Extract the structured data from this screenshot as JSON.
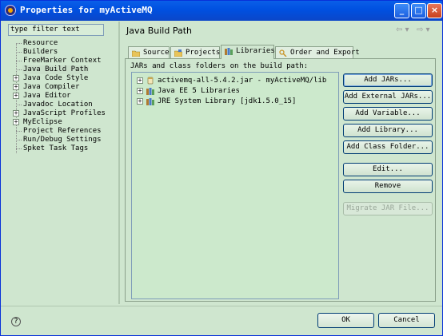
{
  "window": {
    "title": "Properties for myActiveMQ",
    "controls": {
      "minimize": "_",
      "maximize": "□",
      "close": "×"
    }
  },
  "sidebar": {
    "filter_placeholder": "type filter text",
    "items": [
      {
        "label": "Resource",
        "expandable": false
      },
      {
        "label": "Builders",
        "expandable": false
      },
      {
        "label": "FreeMarker Context",
        "expandable": false
      },
      {
        "label": "Java Build Path",
        "expandable": false,
        "selected": true
      },
      {
        "label": "Java Code Style",
        "expandable": true
      },
      {
        "label": "Java Compiler",
        "expandable": true
      },
      {
        "label": "Java Editor",
        "expandable": true
      },
      {
        "label": "Javadoc Location",
        "expandable": false
      },
      {
        "label": "JavaScript Profiles",
        "expandable": true
      },
      {
        "label": "MyEclipse",
        "expandable": true
      },
      {
        "label": "Project References",
        "expandable": false
      },
      {
        "label": "Run/Debug Settings",
        "expandable": false
      },
      {
        "label": "Spket Task Tags",
        "expandable": false
      }
    ]
  },
  "main": {
    "title": "Java Build Path",
    "nav": {
      "back": "⇦ ▾",
      "forward": "⇨ ▾"
    },
    "tabs": [
      {
        "label": "Source",
        "icon": "source-folder-icon"
      },
      {
        "label": "Projects",
        "icon": "projects-icon"
      },
      {
        "label": "Libraries",
        "icon": "libraries-icon",
        "active": true
      },
      {
        "label": "Order and Export",
        "icon": "order-export-icon"
      }
    ],
    "list_label": "JARs and class folders on the build path:",
    "libraries": [
      {
        "label": "activemq-all-5.4.2.jar - myActiveMQ/lib",
        "icon": "jar-icon"
      },
      {
        "label": "Java EE 5 Libraries",
        "icon": "library-icon"
      },
      {
        "label": "JRE System Library [jdk1.5.0_15]",
        "icon": "library-icon"
      }
    ],
    "buttons": [
      {
        "label": "Add JARs...",
        "enabled": true,
        "default": true
      },
      {
        "label": "Add External JARs...",
        "enabled": true
      },
      {
        "label": "Add Variable...",
        "enabled": true
      },
      {
        "label": "Add Library...",
        "enabled": true
      },
      {
        "label": "Add Class Folder...",
        "enabled": true
      },
      {
        "label": "Edit...",
        "enabled": true
      },
      {
        "label": "Remove",
        "enabled": true
      },
      {
        "label": "Migrate JAR File...",
        "enabled": false
      }
    ]
  },
  "footer": {
    "help": "?",
    "ok_label": "OK",
    "cancel_label": "Cancel"
  },
  "colors": {
    "titlebar": "#0055e5",
    "background": "#cfe6cf",
    "list_background": "#cce9cc"
  }
}
